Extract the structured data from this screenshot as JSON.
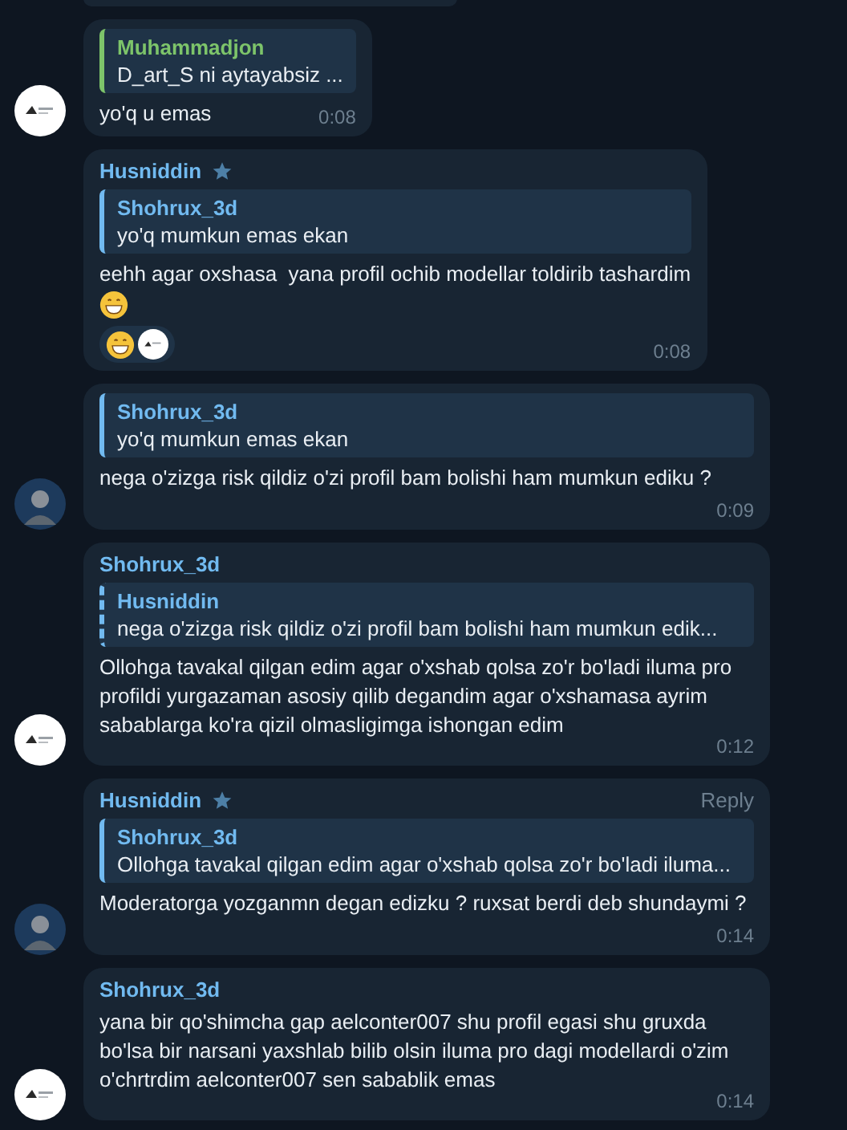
{
  "messages": [
    {
      "reply": {
        "name": "Muhammadjon",
        "text": "D_art_S ni aytayabsiz ...",
        "color": "#7dc46a",
        "dashed": false
      },
      "text": "yo'q u emas",
      "time": "0:08",
      "avatar": {
        "kind": "logo"
      }
    },
    {
      "sender": {
        "name": "Husniddin",
        "color": "#71baf0",
        "starred": true
      },
      "reply": {
        "name": "Shohrux_3d",
        "text": "yo'q mumkun emas ekan",
        "color": "#71baf0",
        "dashed": false
      },
      "text": "eehh agar oxshasa  yana profil ochib modellar toldirib tashardim",
      "trailing_emoji": true,
      "reactions": [
        {
          "kind": "grin"
        }
      ],
      "time": "0:08"
    },
    {
      "reply": {
        "name": "Shohrux_3d",
        "text": "yo'q mumkun emas ekan",
        "color": "#71baf0",
        "dashed": false
      },
      "text": "nega o'zizga risk qildiz o'zi profil bam bolishi ham mumkun ediku ?",
      "time": "0:09",
      "avatar": {
        "kind": "person"
      }
    },
    {
      "sender": {
        "name": "Shohrux_3d",
        "color": "#71baf0",
        "starred": false
      },
      "reply": {
        "name": "Husniddin",
        "text": "nega o'zizga risk qildiz o'zi profil bam bolishi ham mumkun edik...",
        "color": "#71baf0",
        "dashed": true
      },
      "text": "Ollohga tavakal qilgan edim agar o'xshab qolsa zo'r bo'ladi iluma pro profildi yurgazaman asosiy qilib degandim agar o'xshamasa ayrim sabablarga ko'ra qizil olmasligimga ishongan edim",
      "time": "0:12",
      "avatar": {
        "kind": "logo"
      }
    },
    {
      "sender": {
        "name": "Husniddin",
        "color": "#71baf0",
        "starred": true
      },
      "action": "Reply",
      "reply": {
        "name": "Shohrux_3d",
        "text": "Ollohga tavakal qilgan edim agar o'xshab qolsa zo'r bo'ladi iluma...",
        "color": "#71baf0",
        "dashed": false
      },
      "text": "Moderatorga yozganmn degan edizku ? ruxsat berdi deb shundaymi ?",
      "time": "0:14",
      "avatar": {
        "kind": "person"
      }
    },
    {
      "sender": {
        "name": "Shohrux_3d",
        "color": "#71baf0",
        "starred": false
      },
      "text": "yana bir qo'shimcha gap aelconter007 shu profil egasi shu gruxda bo'lsa bir narsani yaxshlab bilib olsin iluma pro dagi modellardi o'zim o'chrtrdim aelconter007 sen sabablik emas",
      "time": "0:14",
      "avatar": {
        "kind": "logo"
      }
    }
  ]
}
